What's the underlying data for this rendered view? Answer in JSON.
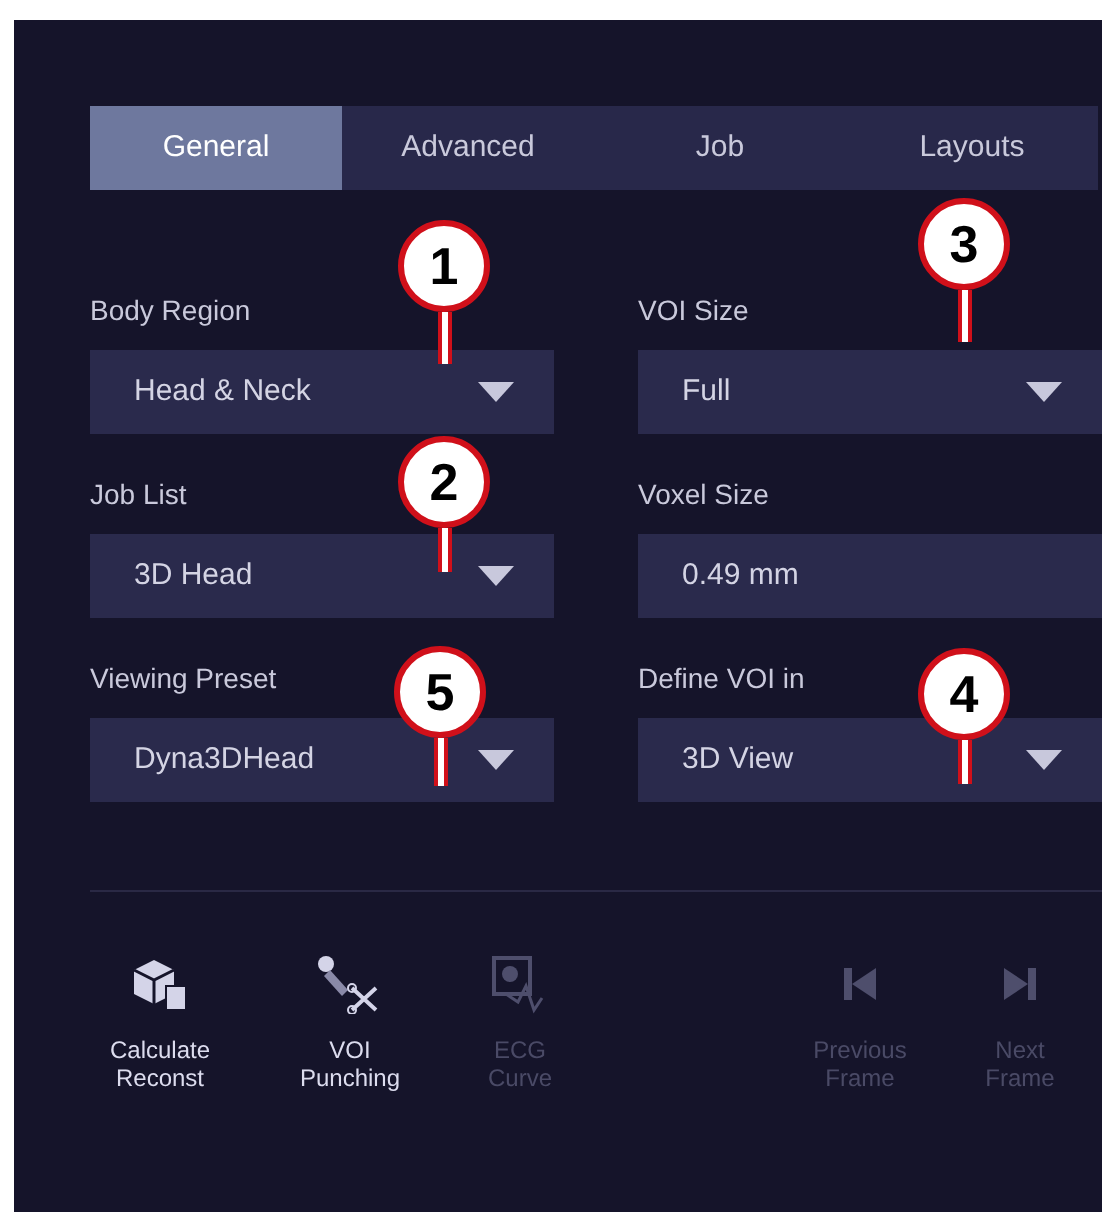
{
  "tabs": [
    {
      "label": "General",
      "selected": true
    },
    {
      "label": "Advanced",
      "selected": false
    },
    {
      "label": "Job",
      "selected": false
    },
    {
      "label": "Layouts",
      "selected": false
    }
  ],
  "fields": [
    {
      "label": "Body Region",
      "value": "Head & Neck",
      "kind": "dropdown"
    },
    {
      "label": "VOI Size",
      "value": "Full",
      "kind": "dropdown"
    },
    {
      "label": "Job List",
      "value": "3D Head",
      "kind": "dropdown"
    },
    {
      "label": "Voxel Size",
      "value": "0.49 mm",
      "kind": "field"
    },
    {
      "label": "Viewing Preset",
      "value": "Dyna3DHead",
      "kind": "dropdown"
    },
    {
      "label": "Define VOI in",
      "value": "3D View",
      "kind": "dropdown"
    }
  ],
  "callouts": [
    {
      "number": "1"
    },
    {
      "number": "3"
    },
    {
      "number": "2"
    },
    {
      "number": "5"
    },
    {
      "number": "4"
    }
  ],
  "toolbar": [
    {
      "label": "Calculate Reconst",
      "kind": "reconstruct",
      "disabled": false
    },
    {
      "label": "VOI Punching",
      "kind": "punch",
      "disabled": false
    },
    {
      "label": "ECG Curve",
      "kind": "ecg",
      "disabled": true
    },
    {
      "label": "Previous Frame",
      "kind": "previous",
      "disabled": true
    },
    {
      "label": "Next Frame",
      "kind": "next",
      "disabled": true
    }
  ]
}
